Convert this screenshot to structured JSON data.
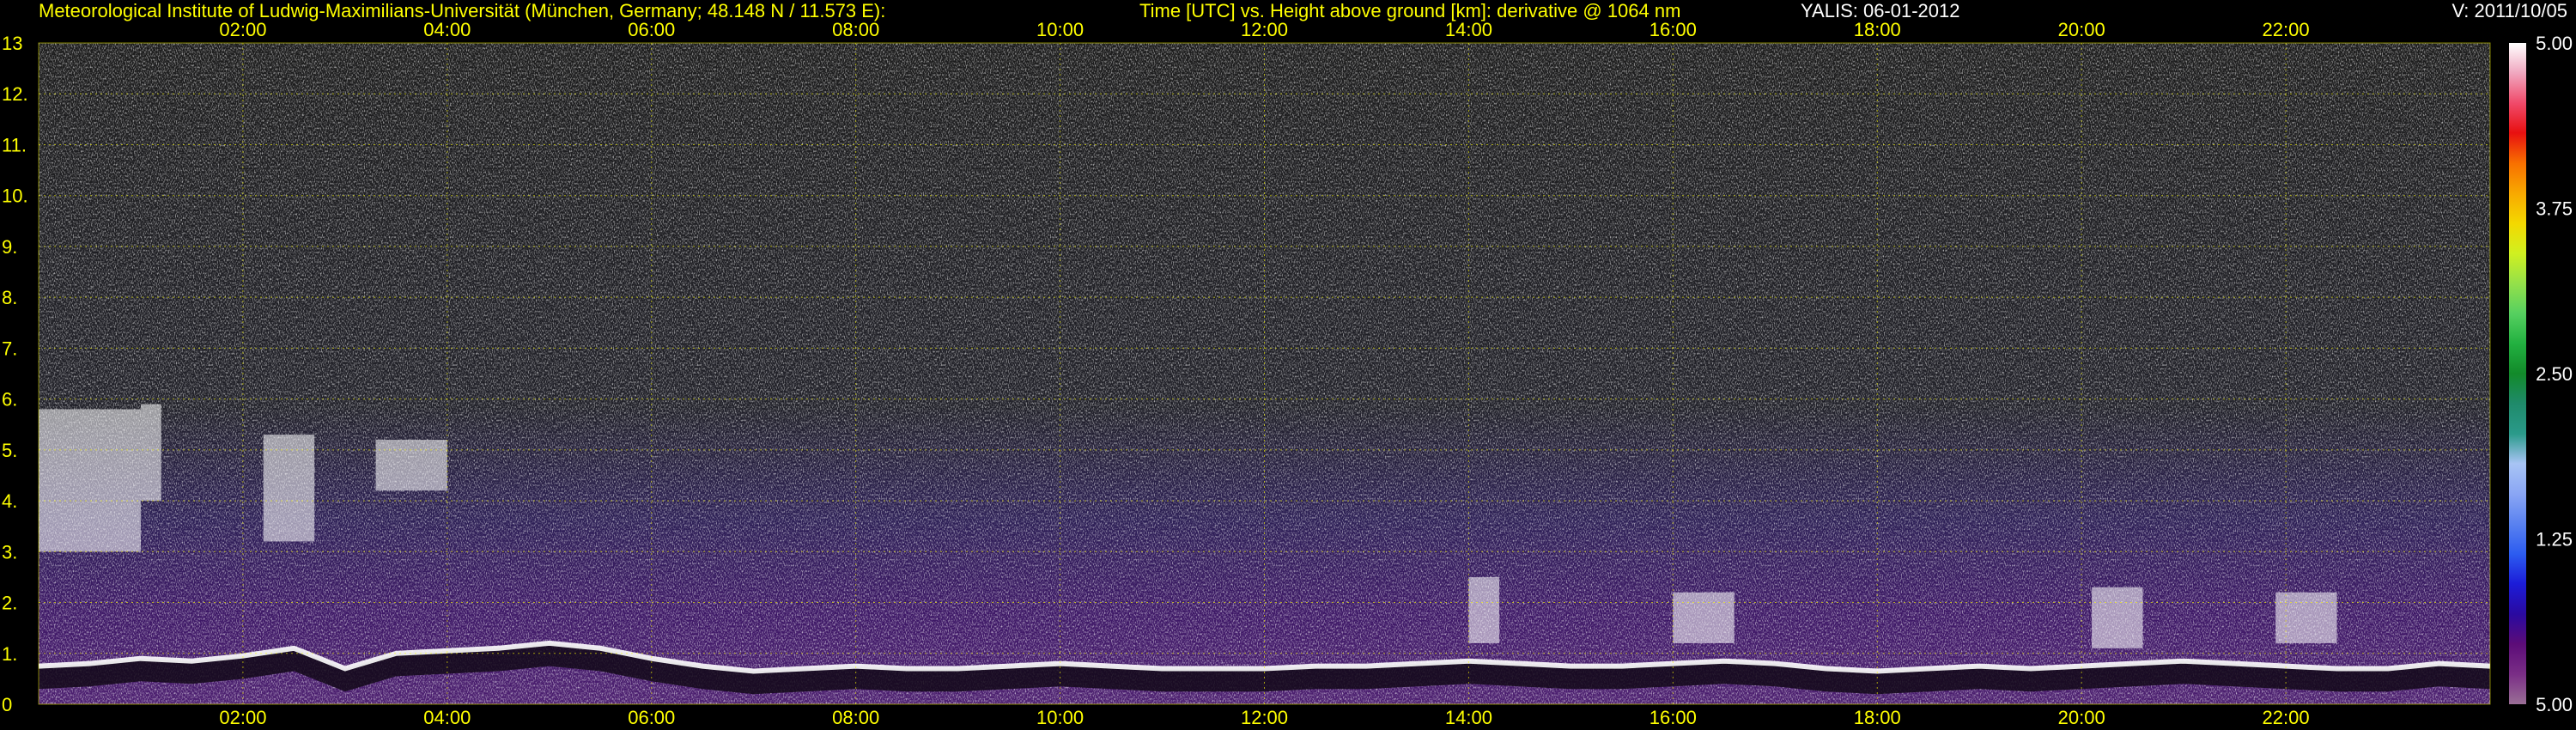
{
  "header": {
    "institute": "Meteorological Institute of Ludwig-Maximilians-Universität (München, Germany; 48.148 N / 11.573 E):",
    "plot_title": "Time [UTC] vs. Height above ground [km]: derivative @ 1064 nm",
    "instrument_date": "YALIS: 06-01-2012",
    "version": "V: 2011/10/05"
  },
  "chart_data": {
    "type": "heatmap",
    "title": "Time [UTC] vs. Height above ground [km]: derivative @ 1064 nm",
    "xlabel": "Time [UTC]",
    "ylabel": "Height above ground [km]",
    "xlim": [
      "00:00",
      "24:00"
    ],
    "ylim": [
      0,
      13
    ],
    "x_ticks": [
      "02:00",
      "04:00",
      "06:00",
      "08:00",
      "10:00",
      "12:00",
      "14:00",
      "16:00",
      "18:00",
      "20:00",
      "22:00"
    ],
    "y_ticks": [
      "0",
      "1.",
      "2.",
      "3.",
      "4.",
      "5.",
      "6.",
      "7.",
      "8.",
      "9.",
      "10.",
      "11.",
      "12.",
      "13"
    ],
    "grid": true,
    "colorbar": {
      "ticks": [
        "5.00",
        "3.75",
        "2.50",
        "1.25",
        "5.00"
      ],
      "colors": [
        "#9a6f96",
        "#7a2e86",
        "#5c0c78",
        "#2a0aa0",
        "#1c1cd8",
        "#2c5cf0",
        "#5a82f0",
        "#8aa6f4",
        "#a8c4f4",
        "#2a9a8a",
        "#1f8a6a",
        "#128a2a",
        "#22b040",
        "#56d060",
        "#94e04a",
        "#d0f020",
        "#f4d800",
        "#f8a800",
        "#f87000",
        "#e81010",
        "#f04a6a",
        "#f0a8c0",
        "#ffffff"
      ]
    },
    "boundary_layer_km": [
      {
        "t": 0.0,
        "h": 0.75
      },
      {
        "t": 0.5,
        "h": 0.8
      },
      {
        "t": 1.0,
        "h": 0.9
      },
      {
        "t": 1.5,
        "h": 0.85
      },
      {
        "t": 2.0,
        "h": 0.95
      },
      {
        "t": 2.5,
        "h": 1.1
      },
      {
        "t": 3.0,
        "h": 0.7
      },
      {
        "t": 3.5,
        "h": 1.0
      },
      {
        "t": 4.0,
        "h": 1.05
      },
      {
        "t": 4.5,
        "h": 1.1
      },
      {
        "t": 5.0,
        "h": 1.2
      },
      {
        "t": 5.5,
        "h": 1.1
      },
      {
        "t": 6.0,
        "h": 0.9
      },
      {
        "t": 6.5,
        "h": 0.75
      },
      {
        "t": 7.0,
        "h": 0.65
      },
      {
        "t": 7.5,
        "h": 0.7
      },
      {
        "t": 8.0,
        "h": 0.75
      },
      {
        "t": 8.5,
        "h": 0.7
      },
      {
        "t": 9.0,
        "h": 0.7
      },
      {
        "t": 9.5,
        "h": 0.75
      },
      {
        "t": 10.0,
        "h": 0.8
      },
      {
        "t": 10.5,
        "h": 0.75
      },
      {
        "t": 11.0,
        "h": 0.7
      },
      {
        "t": 11.5,
        "h": 0.7
      },
      {
        "t": 12.0,
        "h": 0.7
      },
      {
        "t": 12.5,
        "h": 0.75
      },
      {
        "t": 13.0,
        "h": 0.75
      },
      {
        "t": 13.5,
        "h": 0.8
      },
      {
        "t": 14.0,
        "h": 0.85
      },
      {
        "t": 14.5,
        "h": 0.8
      },
      {
        "t": 15.0,
        "h": 0.75
      },
      {
        "t": 15.5,
        "h": 0.75
      },
      {
        "t": 16.0,
        "h": 0.8
      },
      {
        "t": 16.5,
        "h": 0.85
      },
      {
        "t": 17.0,
        "h": 0.8
      },
      {
        "t": 17.5,
        "h": 0.7
      },
      {
        "t": 18.0,
        "h": 0.65
      },
      {
        "t": 18.5,
        "h": 0.7
      },
      {
        "t": 19.0,
        "h": 0.75
      },
      {
        "t": 19.5,
        "h": 0.7
      },
      {
        "t": 20.0,
        "h": 0.75
      },
      {
        "t": 20.5,
        "h": 0.8
      },
      {
        "t": 21.0,
        "h": 0.85
      },
      {
        "t": 21.5,
        "h": 0.8
      },
      {
        "t": 22.0,
        "h": 0.75
      },
      {
        "t": 22.5,
        "h": 0.7
      },
      {
        "t": 23.0,
        "h": 0.7
      },
      {
        "t": 23.5,
        "h": 0.8
      },
      {
        "t": 24.0,
        "h": 0.75
      }
    ],
    "aerosol_layers": [
      {
        "t0": 0.0,
        "t1": 1.0,
        "h0": 3.0,
        "h1": 5.8
      },
      {
        "t0": 1.0,
        "t1": 1.2,
        "h0": 4.0,
        "h1": 5.9
      },
      {
        "t0": 2.2,
        "t1": 2.7,
        "h0": 3.2,
        "h1": 5.3
      },
      {
        "t0": 3.3,
        "t1": 4.0,
        "h0": 4.2,
        "h1": 5.2
      },
      {
        "t0": 14.0,
        "t1": 14.3,
        "h0": 1.2,
        "h1": 2.5
      },
      {
        "t0": 16.0,
        "t1": 16.6,
        "h0": 1.2,
        "h1": 2.2
      },
      {
        "t0": 20.1,
        "t1": 20.6,
        "h0": 1.1,
        "h1": 2.3
      },
      {
        "t0": 21.9,
        "t1": 22.5,
        "h0": 1.2,
        "h1": 2.2
      }
    ]
  }
}
